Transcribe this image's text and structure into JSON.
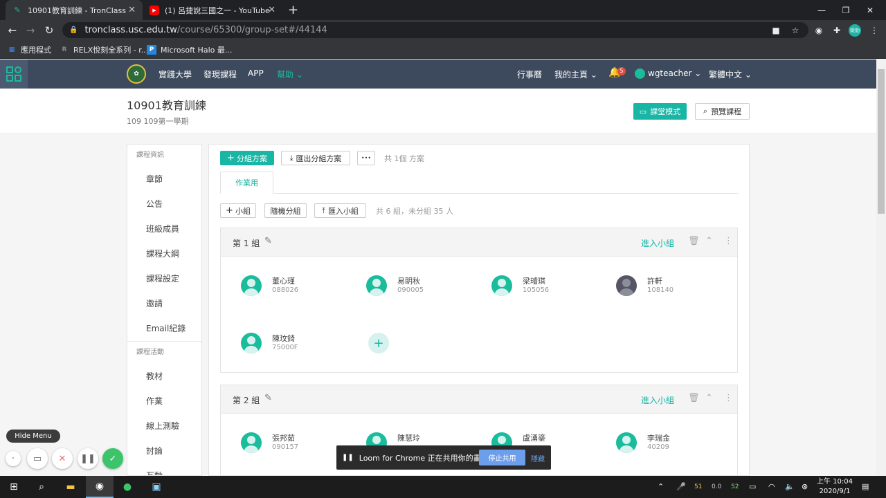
{
  "browser": {
    "tabs": [
      {
        "title": "10901教育訓練 - TronClass",
        "active": true
      },
      {
        "title": "(1) 呂捷說三國之一 - YouTube",
        "active": false
      }
    ],
    "url_host": "tronclass.usc.edu.tw",
    "url_path": "/course/65300/group-set#/44144",
    "bookmarks": [
      {
        "label": "應用程式",
        "icon": "apps-grid-icon"
      },
      {
        "label": "RELX悅刻全系列 - r...",
        "icon": "relx-icon"
      },
      {
        "label": "Microsoft Halo 最...",
        "icon": "p-icon"
      }
    ],
    "profile_label": "鍛動"
  },
  "app_header": {
    "nav": [
      "實踐大學",
      "發現課程",
      "APP",
      "幫助"
    ],
    "right": {
      "calendar": "行事曆",
      "home": "我的主頁",
      "notifications": "5",
      "user": "wgteacher",
      "language": "繁體中文"
    },
    "colors": {
      "bar": "#3d4a5d",
      "accent": "#19b5a5"
    }
  },
  "course": {
    "title": "10901教育訓練",
    "subtitle": "109 109第一學期",
    "teach_mode": "課堂模式",
    "preview": "預覽課程"
  },
  "sidebar": {
    "section1": "課程資訊",
    "items1": [
      "章節",
      "公告",
      "班級成員",
      "課程大綱",
      "課程設定",
      "邀請",
      "Email紀錄"
    ],
    "section2": "課程活動",
    "items2": [
      "教材",
      "作業",
      "線上測驗",
      "討論",
      "互動"
    ]
  },
  "main": {
    "add_plan": "分組方案",
    "export_plan": "匯出分組方案",
    "more": "•••",
    "plan_count": "共 1個 方案",
    "tab": "作業用",
    "add_group": "小組",
    "random_group": "隨機分組",
    "import_group": "匯入小組",
    "summary": "共 6 組，未分組 35 人",
    "enter_group": "進入小組",
    "groups": [
      {
        "name": "第 1 組",
        "members": [
          {
            "name": "董心瑾",
            "id": "088026"
          },
          {
            "name": "易眀秋",
            "id": "090005"
          },
          {
            "name": "梁璿琪",
            "id": "105056"
          },
          {
            "name": "許軒",
            "id": "108140"
          },
          {
            "name": "陳玟錡",
            "id": "75000F"
          }
        ]
      },
      {
        "name": "第 2 組",
        "members": [
          {
            "name": "張邦茹",
            "id": "090157"
          },
          {
            "name": "陳慧玲",
            "id": ""
          },
          {
            "name": "盧湧鎏",
            "id": ""
          },
          {
            "name": "李瑞金",
            "id": "40209"
          }
        ]
      }
    ]
  },
  "loom": {
    "message": "Loom for Chrome 正在共用你的畫面。",
    "stop": "停止共用",
    "hide": "隱藏",
    "hide_menu": "Hide Menu"
  },
  "taskbar": {
    "tray_values": [
      "51",
      "0.0",
      "52"
    ],
    "time": "上午 10:04",
    "date": "2020/9/1"
  }
}
